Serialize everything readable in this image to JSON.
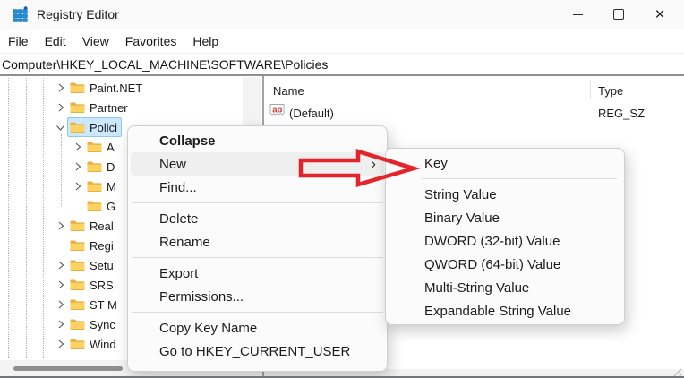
{
  "window": {
    "title": "Registry Editor"
  },
  "icons": {
    "app": "registry-grid-icon",
    "minimize_glyph": "–",
    "maximize_glyph": "▢",
    "close_glyph": "×",
    "submenu_arrow": "›",
    "tree_collapsed": "›",
    "tree_expanded": "⌄",
    "value_icon": "ab"
  },
  "menubar": {
    "items": [
      "File",
      "Edit",
      "View",
      "Favorites",
      "Help"
    ]
  },
  "address": {
    "value": "Computer\\HKEY_LOCAL_MACHINE\\SOFTWARE\\Policies"
  },
  "tree": {
    "items": [
      {
        "label": "Paint.NET",
        "level": 1,
        "chevron": "collapsed",
        "selected": false
      },
      {
        "label": "Partner",
        "level": 1,
        "chevron": "collapsed",
        "selected": false
      },
      {
        "label": "Polici",
        "level": 1,
        "chevron": "expanded",
        "selected": true
      },
      {
        "label": "A",
        "level": 2,
        "chevron": "collapsed",
        "selected": false
      },
      {
        "label": "D",
        "level": 2,
        "chevron": "collapsed",
        "selected": false
      },
      {
        "label": "M",
        "level": 2,
        "chevron": "collapsed",
        "selected": false
      },
      {
        "label": "G",
        "level": 2,
        "chevron": "none",
        "selected": false
      },
      {
        "label": "Real",
        "level": 1,
        "chevron": "collapsed",
        "selected": false
      },
      {
        "label": "Regi",
        "level": 1,
        "chevron": "none",
        "selected": false
      },
      {
        "label": "Setu",
        "level": 1,
        "chevron": "collapsed",
        "selected": false
      },
      {
        "label": "SRS",
        "level": 1,
        "chevron": "collapsed",
        "selected": false
      },
      {
        "label": "ST M",
        "level": 1,
        "chevron": "collapsed",
        "selected": false
      },
      {
        "label": "Sync",
        "level": 1,
        "chevron": "collapsed",
        "selected": false
      },
      {
        "label": "Wind",
        "level": 1,
        "chevron": "collapsed",
        "selected": false
      }
    ]
  },
  "list": {
    "columns": [
      "Name",
      "Type"
    ],
    "rows": [
      {
        "name": "(Default)",
        "type": "REG_SZ",
        "icon": "string-value-icon"
      }
    ]
  },
  "context_menu": {
    "items": [
      {
        "type": "item",
        "label": "Collapse",
        "bold": true
      },
      {
        "type": "item",
        "label": "New",
        "hovered": true,
        "has_submenu": true
      },
      {
        "type": "item",
        "label": "Find..."
      },
      {
        "type": "separator"
      },
      {
        "type": "item",
        "label": "Delete"
      },
      {
        "type": "item",
        "label": "Rename"
      },
      {
        "type": "separator"
      },
      {
        "type": "item",
        "label": "Export"
      },
      {
        "type": "item",
        "label": "Permissions..."
      },
      {
        "type": "separator"
      },
      {
        "type": "item",
        "label": "Copy Key Name"
      },
      {
        "type": "item",
        "label": "Go to HKEY_CURRENT_USER"
      }
    ]
  },
  "new_submenu": {
    "items": [
      {
        "type": "item",
        "label": "Key"
      },
      {
        "type": "separator"
      },
      {
        "type": "item",
        "label": "String Value"
      },
      {
        "type": "item",
        "label": "Binary Value"
      },
      {
        "type": "item",
        "label": "DWORD (32-bit) Value"
      },
      {
        "type": "item",
        "label": "QWORD (64-bit) Value"
      },
      {
        "type": "item",
        "label": "Multi-String Value"
      },
      {
        "type": "item",
        "label": "Expandable String Value"
      }
    ]
  },
  "colors": {
    "selection_bg": "#cce8ff",
    "selection_border": "#8ec9f2",
    "annotation_arrow_red": "#e3242b",
    "folder_front": "#fcd260",
    "folder_back": "#e9ae44",
    "menu_hover": "#efefef",
    "value_icon_letters": "#d0342c"
  }
}
